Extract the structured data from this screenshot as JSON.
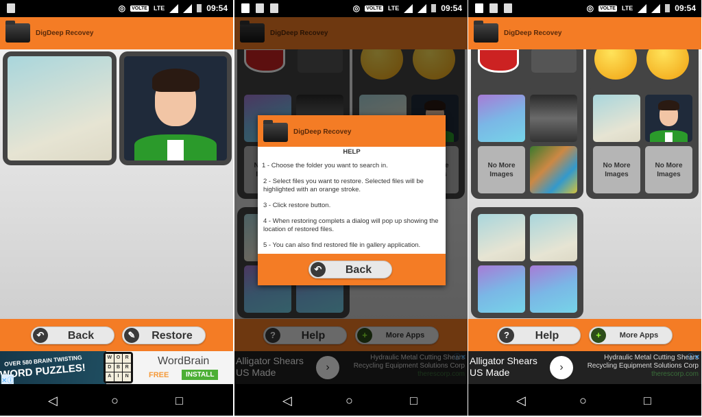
{
  "app_title": "DigDeep Recovey",
  "status": {
    "time": "09:54",
    "volte": "VOLTE",
    "lte": "LTE"
  },
  "screen1": {
    "buttons": {
      "back": "Back",
      "restore": "Restore"
    },
    "ad": {
      "headline1": "OVER 580 BRAIN TWISTING",
      "headline2": "WORD PUZZLES!",
      "letters": [
        "W",
        "O",
        "R",
        "D",
        "B",
        "R",
        "A",
        "I",
        "N"
      ],
      "app_name": "WordBrain",
      "price": "FREE",
      "install": "INSTALL"
    }
  },
  "screen2": {
    "dialog": {
      "heading": "HELP",
      "steps": [
        "1 - Choose the folder you want to search in.",
        "2 - Select files you want to restore. Selected files will be highlighted with an orange stroke.",
        "3 - Click restore button.",
        "4 - When restoring complets a dialog will pop up showing the location of restored files.",
        "5 - You can also find restored file in gallery application."
      ],
      "back": "Back"
    }
  },
  "buttons": {
    "help": "Help",
    "more_apps": "More Apps"
  },
  "placeholder": "No More Images",
  "ad2": {
    "left1": "Alligator Shears",
    "left2": "US Made",
    "right1": "Hydraulic Metal Cutting Shears",
    "right2": "Recycling Equipment Solutions Corp",
    "url": "therescorp.com"
  },
  "colors": {
    "accent": "#f47c25",
    "tile": "#444444",
    "install": "#4caf35"
  }
}
